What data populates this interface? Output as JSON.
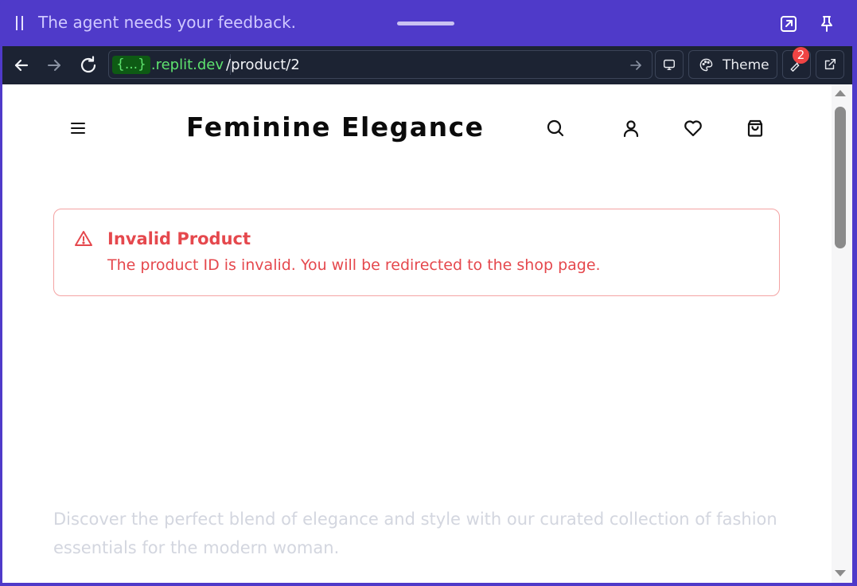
{
  "banner": {
    "message": "The agent needs your feedback."
  },
  "browser": {
    "url_badge": "{...}",
    "url_domain": ".replit.dev",
    "url_path": "/product/2",
    "theme_label": "Theme",
    "notification_count": "2"
  },
  "site": {
    "brand": "Feminine Elegance",
    "alert": {
      "title": "Invalid Product",
      "description": "The product ID is invalid. You will be redirected to the shop page."
    },
    "tagline": "Discover the perfect blend of elegance and style with our curated collection of fashion essentials for the modern woman."
  },
  "colors": {
    "banner_bg": "#4f3ac9",
    "toolbar_bg": "#1c2333",
    "url_accent": "#5ee36e",
    "alert_red": "#e5484d",
    "alert_border": "#f4a3a3",
    "badge_red": "#ef4444"
  },
  "icons": {
    "banner": [
      "pause-icon",
      "expand-icon",
      "pin-icon"
    ],
    "toolbar": [
      "back-arrow-icon",
      "forward-arrow-icon",
      "reload-icon",
      "go-arrow-icon",
      "monitor-icon",
      "palette-icon",
      "wrench-icon",
      "external-link-icon"
    ],
    "header": [
      "hamburger-menu-icon",
      "search-icon",
      "user-icon",
      "heart-icon",
      "shopping-bag-icon"
    ],
    "alert": "warning-triangle-icon"
  }
}
